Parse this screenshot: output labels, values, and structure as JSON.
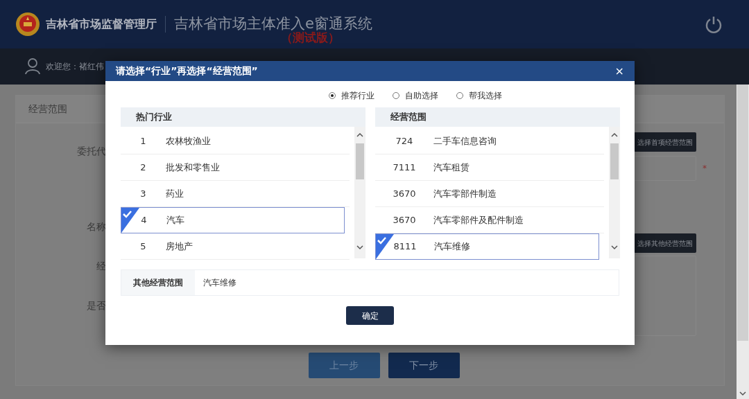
{
  "header": {
    "org_name": "吉林省市场监督管理厅",
    "system_title": "吉林省市场主体准入e窗通系统",
    "test_badge": "（测试版）"
  },
  "user_bar": {
    "greeting": "欢迎您：褚红伟"
  },
  "background_page": {
    "section_title": "经营范围",
    "labels": [
      "委托代",
      "名称",
      "经",
      "是否"
    ],
    "first_scope_button": "选择首项经营范围",
    "required_mark": "*",
    "other_scope_button": "选择其他经营范围",
    "previous": "上一步",
    "next": "下一步"
  },
  "dialog": {
    "title": "请选择“行业”再选择“经营范围”",
    "close": "×",
    "radios": [
      {
        "label": "推荐行业",
        "selected": true
      },
      {
        "label": "自助选择",
        "selected": false
      },
      {
        "label": "帮我选择",
        "selected": false
      }
    ],
    "industry_panel": {
      "title": "热门行业",
      "rows": [
        {
          "number": "1",
          "name": "农林牧渔业",
          "selected": false
        },
        {
          "number": "2",
          "name": "批发和零售业",
          "selected": false
        },
        {
          "number": "3",
          "name": "药业",
          "selected": false
        },
        {
          "number": "4",
          "name": "汽车",
          "selected": true
        },
        {
          "number": "5",
          "name": "房地产",
          "selected": false
        }
      ]
    },
    "scope_panel": {
      "title": "经营范围",
      "rows": [
        {
          "number": "724",
          "name": "二手车信息咨询",
          "selected": false
        },
        {
          "number": "7111",
          "name": "汽车租赁",
          "selected": false
        },
        {
          "number": "3670",
          "name": "汽车零部件制造",
          "selected": false
        },
        {
          "number": "3670",
          "name": "汽车零部件及配件制造",
          "selected": false
        },
        {
          "number": "8111",
          "name": "汽车维修",
          "selected": true
        }
      ]
    },
    "other_scope": {
      "label": "其他经营范围",
      "value": "汽车维修"
    },
    "confirm": "确定"
  }
}
